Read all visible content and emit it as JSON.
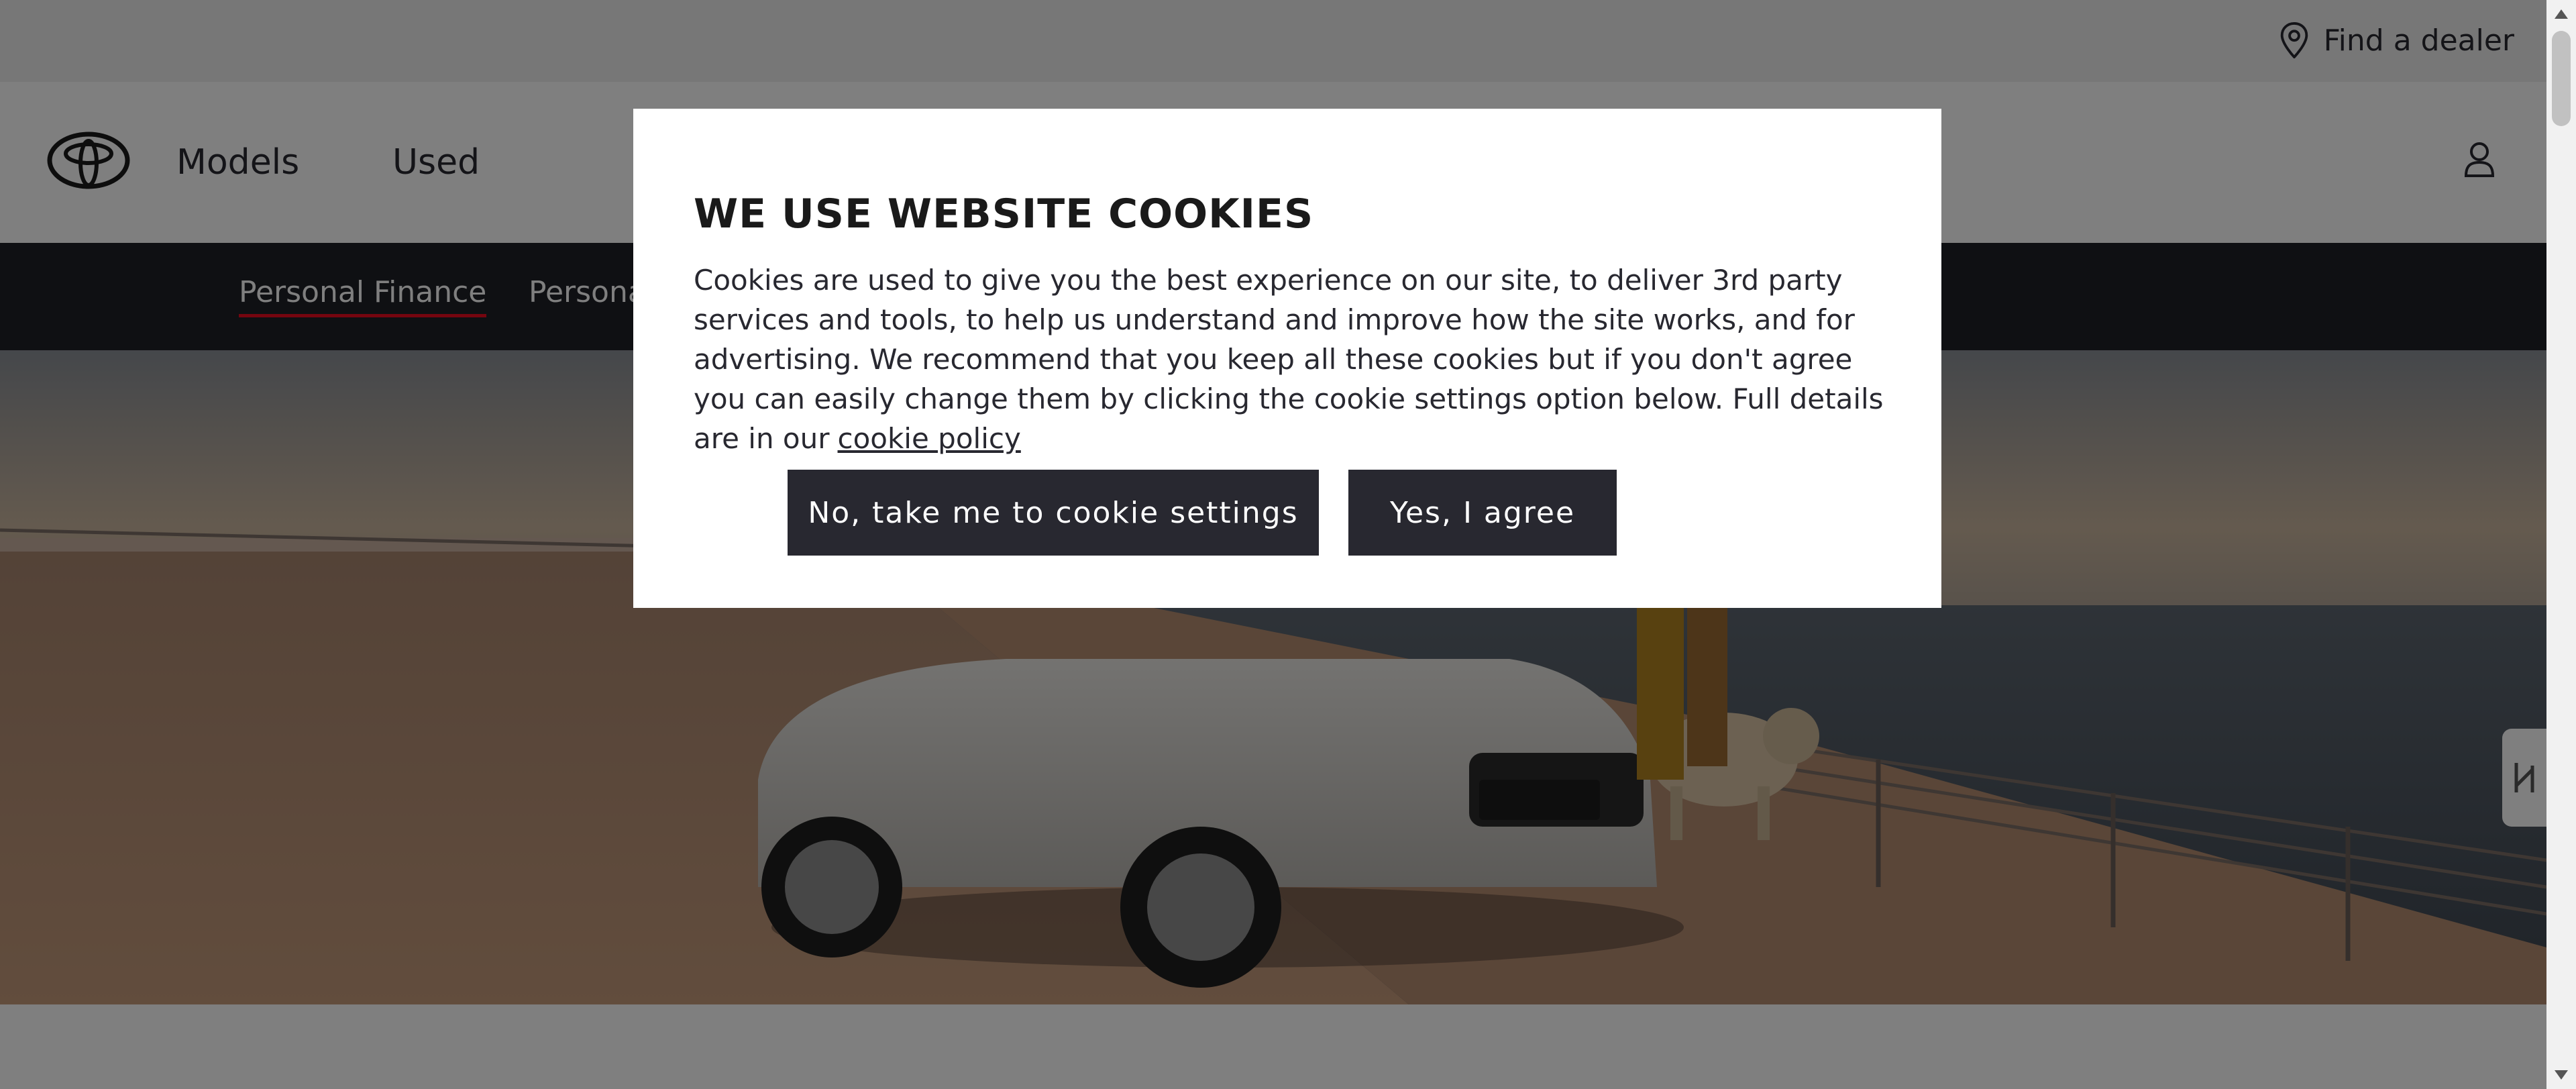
{
  "utility_bar": {
    "find_dealer_label": "Find a dealer",
    "find_dealer_icon": "location-pin-icon"
  },
  "main_nav": {
    "logo": "toyota-logo",
    "items": [
      {
        "label": "Models"
      },
      {
        "label": "Used"
      }
    ],
    "account_icon": "user-icon"
  },
  "sub_nav": {
    "tabs": [
      {
        "label": "Personal Finance",
        "active": true
      },
      {
        "label": "Personal Contract Hire",
        "active": false
      }
    ],
    "accent_color": "#eb0a1e"
  },
  "side_tab_icon": "expand-panel-icon",
  "cookie_modal": {
    "title": "WE USE WEBSITE COOKIES",
    "body": "Cookies are used to give you the best experience on our site, to deliver 3rd party services and tools, to help us understand and improve how the site works, and for advertising. We recommend that you keep all these cookies but if you don't agree you can easily change them by clicking the cookie settings option below. Full details are in our",
    "policy_link": "cookie policy",
    "settings_button": "No, take me to cookie settings",
    "agree_button": "Yes, I agree"
  },
  "colors": {
    "dark": "#282830",
    "subnav_bg": "#1f2027",
    "overlay": "rgba(0,0,0,0.5)"
  }
}
